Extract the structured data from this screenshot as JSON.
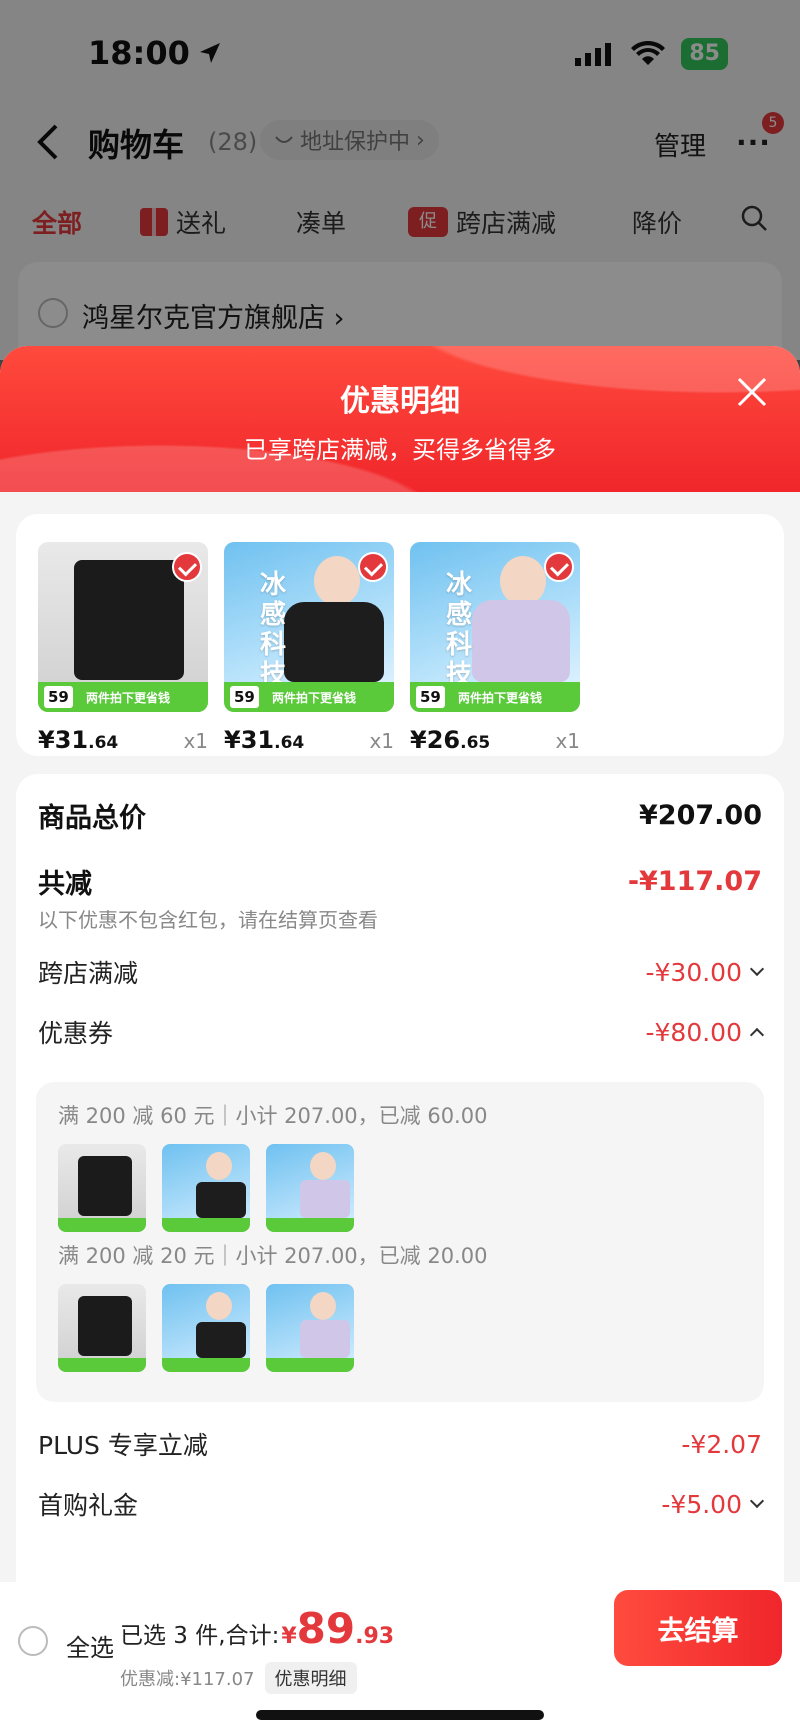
{
  "status": {
    "time": "18:00",
    "battery": "85"
  },
  "nav": {
    "title": "购物车",
    "count": "(28)",
    "address_protect": "地址保护中",
    "manage": "管理",
    "more_badge": "5"
  },
  "tabs": [
    {
      "label": "全部"
    },
    {
      "label": "送礼"
    },
    {
      "label": "凑单"
    },
    {
      "badge": "促",
      "label": "跨店满减"
    },
    {
      "label": "降价"
    }
  ],
  "store": {
    "name": "鸿星尔克官方旗舰店"
  },
  "sheet": {
    "title": "优惠明细",
    "subtitle": "已享跨店满减，买得多省得多"
  },
  "products": [
    {
      "price_int": "¥31",
      "price_dec": ".64",
      "qty": "x1",
      "tag": "",
      "chip": "59",
      "strip": "两件拍下更省钱"
    },
    {
      "price_int": "¥31",
      "price_dec": ".64",
      "qty": "x1",
      "tag": "冰感科技",
      "chip": "59",
      "strip": "两件拍下更省钱"
    },
    {
      "price_int": "¥26",
      "price_dec": ".65",
      "qty": "x1",
      "tag": "冰感科技",
      "chip": "59",
      "strip": "两件拍下更省钱"
    }
  ],
  "detail": {
    "total_label": "商品总价",
    "total_value": "¥207.00",
    "reduce_label": "共减",
    "reduce_value": "-¥117.07",
    "reduce_note": "以下优惠不包含红包，请在结算页查看",
    "cross_store_label": "跨店满减",
    "cross_store_value": "-¥30.00",
    "coupon_label": "优惠券",
    "coupon_value": "-¥80.00",
    "coupon_lines": [
      "满 200 减 60 元｜小计 207.00，已减 60.00",
      "满 200 减 20 元｜小计 207.00，已减 20.00"
    ],
    "plus_label": "PLUS 专享立减",
    "plus_value": "-¥2.07",
    "first_buy_label": "首购礼金",
    "first_buy_value": "-¥5.00"
  },
  "bottom": {
    "select_all": "全选",
    "selected_text": "已选 3 件,合计:",
    "yen": "¥",
    "total_int": "89",
    "total_dec": ".93",
    "discount_text": "优惠减:¥117.07",
    "detail_chip": "优惠明细",
    "checkout": "去结算"
  },
  "colors": {
    "accent": "#e4393c",
    "promo_green": "#5ac93a"
  }
}
